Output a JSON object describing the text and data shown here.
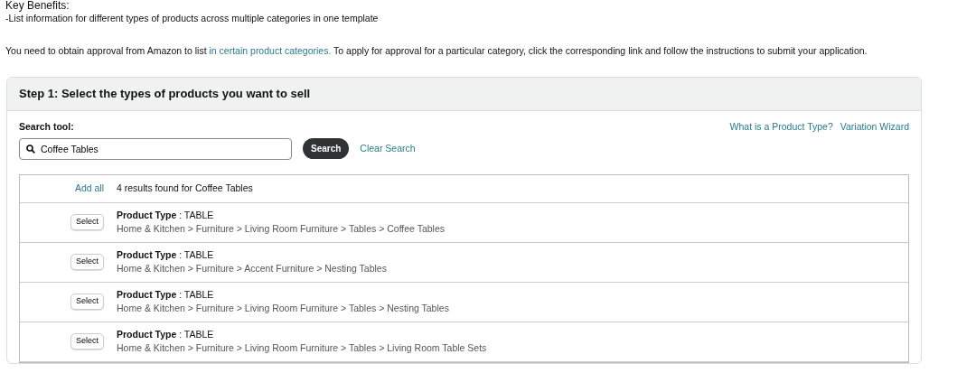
{
  "intro": {
    "heading": "Key Benefits:",
    "benefit": "-List information for different types of products across multiple categories in one template",
    "approval_before": "You need to obtain approval from Amazon to list ",
    "approval_link": "in certain product categories.",
    "approval_after": " To apply for approval for a particular category, click the corresponding link and follow the instructions to submit your application."
  },
  "step": {
    "title": "Step 1: Select the types of products you want to sell",
    "search_label": "Search tool:",
    "search_value": "Coffee Tables",
    "search_button": "Search",
    "clear_link": "Clear Search",
    "help_links": [
      "What is a Product Type?",
      "Variation Wizard"
    ],
    "results": {
      "add_all": "Add all",
      "summary": "4 results found for Coffee Tables",
      "rows": [
        {
          "button": "Select",
          "type_line": "**Product Type** : TABLE",
          "path": "Home & Kitchen > Furniture > Living Room Furniture > Tables > Coffee Tables"
        },
        {
          "button": "Select",
          "type_line": "**Product Type** : TABLE",
          "path": "Home & Kitchen > Furniture > Accent Furniture > Nesting Tables"
        },
        {
          "button": "Select",
          "type_line": "**Product Type** : TABLE",
          "path": "Home & Kitchen > Furniture > Living Room Furniture > Tables > Nesting Tables"
        },
        {
          "button": "Select",
          "type_line": "**Product Type** : TABLE",
          "path": "Home & Kitchen > Furniture > Living Room Furniture > Tables > Living Room Table Sets"
        }
      ]
    }
  }
}
